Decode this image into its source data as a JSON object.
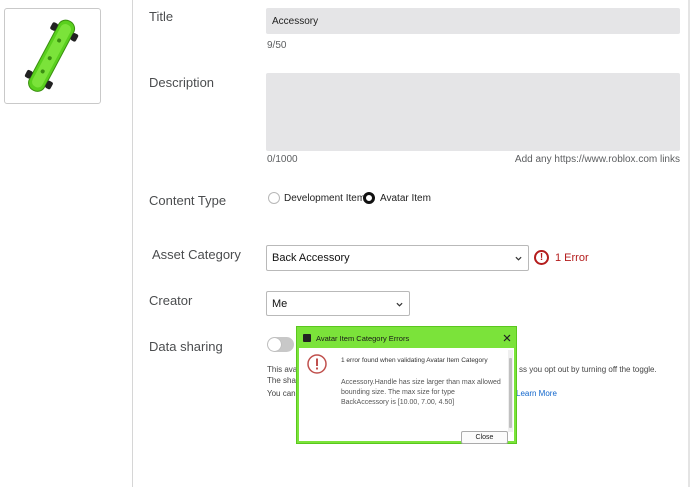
{
  "thumbnail": {
    "alt_icon": "skateboard-icon",
    "accent": "#5ad01e"
  },
  "form": {
    "title": {
      "label": "Title",
      "value": "Accessory",
      "count": "9/50"
    },
    "description": {
      "label": "Description",
      "value": "",
      "count": "0/1000",
      "hint": "Add any https://www.roblox.com links"
    },
    "content_type": {
      "label": "Content Type",
      "options": [
        {
          "label": "Development Item",
          "selected": false
        },
        {
          "label": "Avatar Item",
          "selected": true
        }
      ]
    },
    "asset_category": {
      "label": "Asset Category",
      "value": "Back Accessory",
      "error_text": "1 Error",
      "error_color": "#b41c1c"
    },
    "creator": {
      "label": "Creator",
      "value": "Me"
    },
    "data_sharing": {
      "label": "Data sharing",
      "enabled": false,
      "text_line1_start": "This ava",
      "text_line1_end": "ss you opt out by turning off the toggle.",
      "text_line2_start": "The sha",
      "text_line3_start": "You can",
      "learn_more": "Learn More"
    }
  },
  "dialog": {
    "title": "Avatar Item Category Errors",
    "header_line": "1 error found when validating Avatar Item Category",
    "message_line1": "Accessory.Handle has size larger than max allowed",
    "message_line2": "bounding size. The max size for type",
    "message_line3": "BackAccessory is [10.00, 7.00, 4.50]",
    "close_label": "Close",
    "title_bar_color": "#7be33a",
    "warning_color": "#c0504d"
  }
}
